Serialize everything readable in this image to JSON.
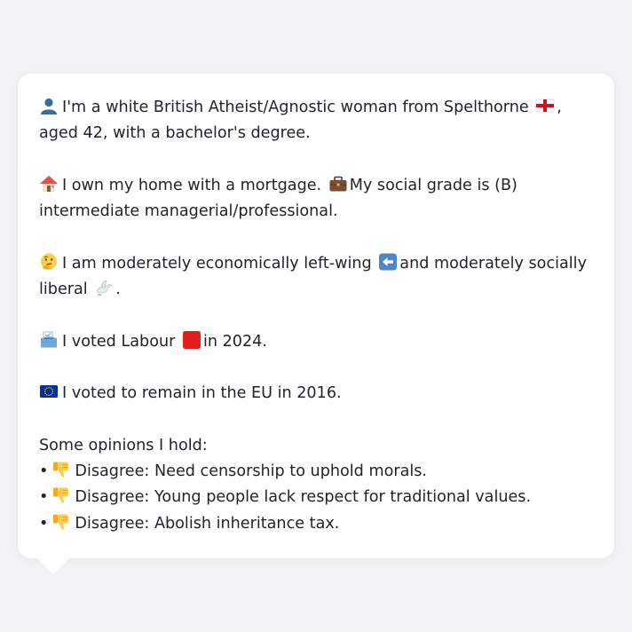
{
  "intro": {
    "text_before_flag": "I'm a white British Atheist/Agnostic woman from Spelthorne",
    "text_after_flag": ", aged 42, with a bachelor's degree."
  },
  "housing": {
    "text_home": "I own my home with a mortgage.",
    "text_grade": "My social grade is (B) intermediate managerial/professional."
  },
  "ideology": {
    "text_before_arrow": "I am moderately economically left-wing",
    "text_after_arrow": "and moderately socially liberal",
    "text_after_dove": "."
  },
  "vote2024": {
    "text_before_box": "I voted Labour",
    "text_after_box": "in 2024."
  },
  "eu": {
    "text": "I voted to remain in the EU in 2016."
  },
  "opinions": {
    "heading": "Some opinions I hold:",
    "bullet": "•",
    "items": [
      "Disagree: Need censorship to uphold morals.",
      "Disagree: Young people lack respect for traditional values.",
      "Disagree: Abolish inheritance tax."
    ]
  },
  "colors": {
    "labour_red": "#e0201b",
    "eu_blue": "#003399",
    "bubble_bg": "#ffffff",
    "page_bg": "#f2f3f5"
  }
}
